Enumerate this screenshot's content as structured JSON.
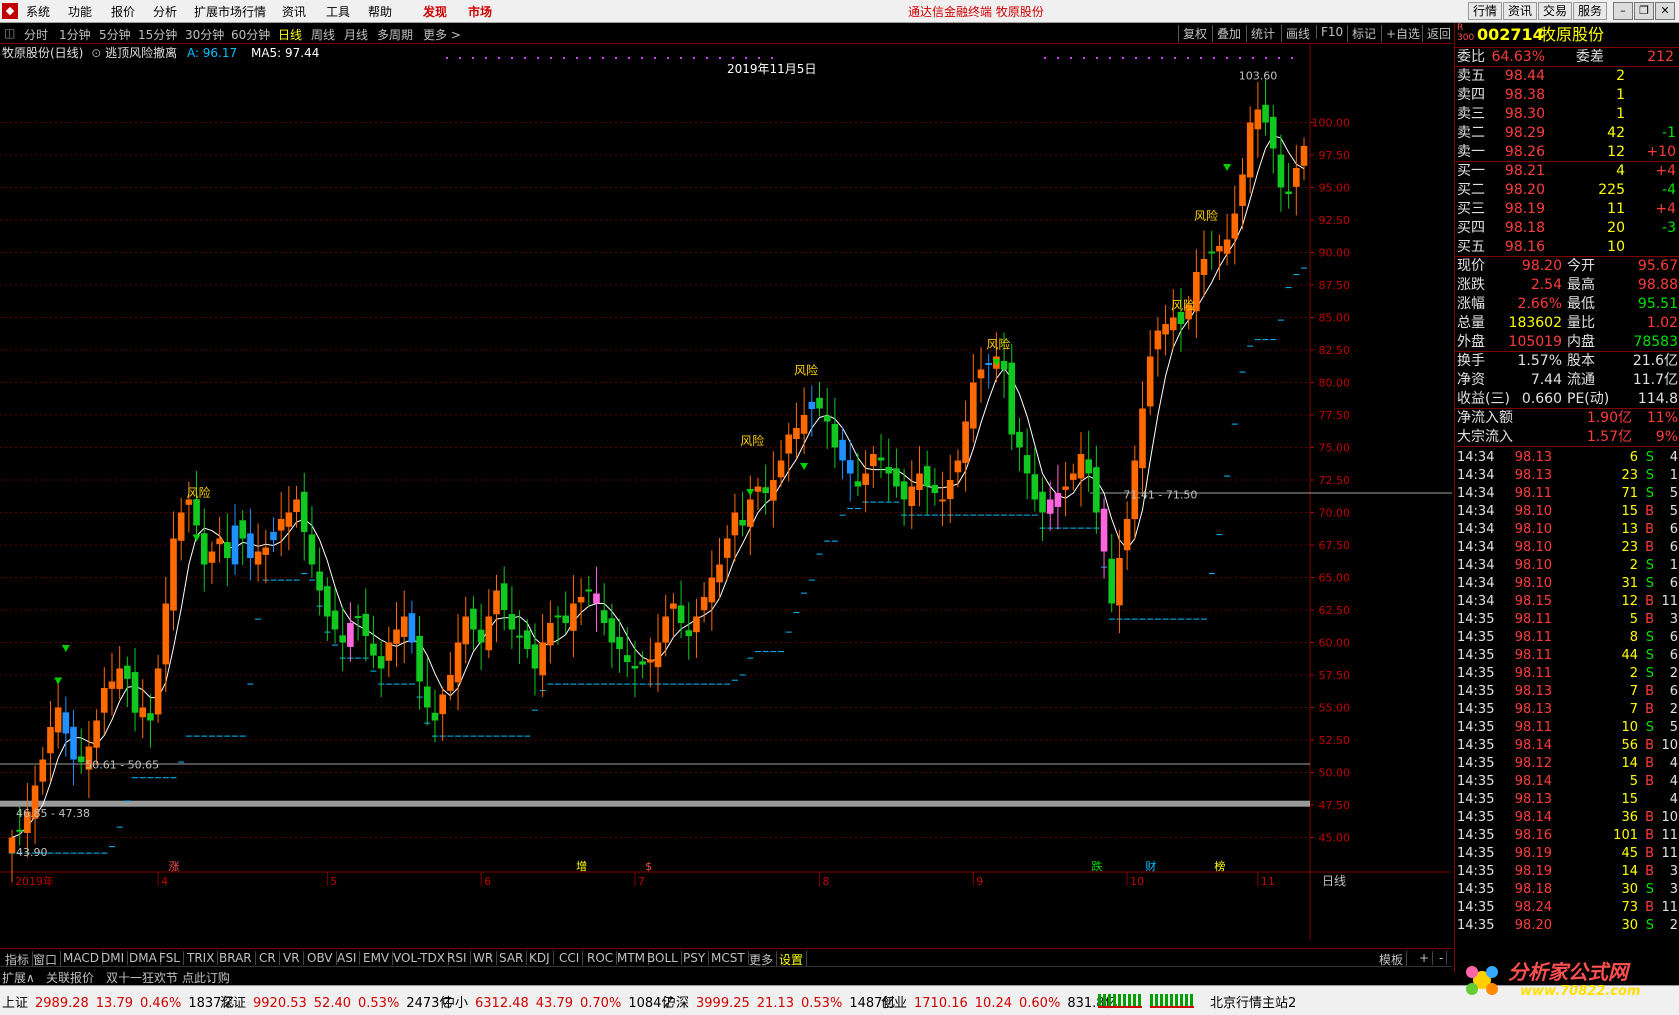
{
  "menu": {
    "items": [
      "系统",
      "功能",
      "报价",
      "分析",
      "扩展市场行情",
      "资讯",
      "工具",
      "帮助"
    ],
    "highlight_items": [
      "发现",
      "市场"
    ],
    "center_title": "通达信金融终端  牧原股份",
    "right_buttons": [
      "行情",
      "资讯",
      "交易",
      "服务"
    ]
  },
  "periods": {
    "items": [
      "分时",
      "1分钟",
      "5分钟",
      "15分钟",
      "30分钟",
      "60分钟",
      "日线",
      "周线",
      "月线",
      "多周期",
      "更多 >"
    ],
    "active": "日线",
    "tools": [
      "复权",
      "叠加",
      "统计",
      "画线",
      "F10",
      "标记",
      "+自选",
      "返回"
    ]
  },
  "chart_header": {
    "title": "牧原股份(日线)",
    "indicator": "逃顶风险撤离",
    "a_label": "A: 96.17",
    "ma_label": "MA5: 97.44",
    "date_label": "2019年11月5日"
  },
  "chart_data": {
    "type": "candlestick",
    "ylim": [
      42.5,
      104.5
    ],
    "y_ticks": [
      45.0,
      47.5,
      50.0,
      52.5,
      55.0,
      57.5,
      60.0,
      62.5,
      65.0,
      67.5,
      70.0,
      72.5,
      75.0,
      77.5,
      80.0,
      82.5,
      85.0,
      87.5,
      90.0,
      92.5,
      95.0,
      97.5,
      100.0
    ],
    "x_labels": [
      "2019年",
      "4",
      "5",
      "6",
      "7",
      "8",
      "9",
      "10",
      "11"
    ],
    "x_label_index": [
      0,
      19,
      41,
      61,
      81,
      105,
      125,
      145,
      162
    ],
    "price_labels": [
      {
        "text": "103.60",
        "i": 159,
        "v": 103.6
      },
      {
        "text": "50.61 - 50.65",
        "i": 9,
        "v": 50.6
      },
      {
        "text": "71.41 - 71.50",
        "i": 144,
        "v": 71.4
      },
      {
        "text": "46.85 - 47.38",
        "i": 0,
        "v": 46.9
      },
      {
        "text": "43.90",
        "i": 0,
        "v": 43.9
      }
    ],
    "risk_labels": [
      {
        "text": "风险",
        "i": 24,
        "v": 71.2
      },
      {
        "text": "风险",
        "i": 96,
        "v": 75.2
      },
      {
        "text": "风险",
        "i": 103,
        "v": 80.6
      },
      {
        "text": "风险",
        "i": 128,
        "v": 82.6
      },
      {
        "text": "风险",
        "i": 152,
        "v": 85.6
      },
      {
        "text": "风险",
        "i": 155,
        "v": 92.5
      }
    ],
    "event_markers": [
      {
        "text": "涨",
        "i": 21,
        "color": "#ff5050"
      },
      {
        "text": "增",
        "i": 74,
        "color": "#ffff00"
      },
      {
        "text": "$",
        "i": 83,
        "color": "#ff5050"
      },
      {
        "text": "跌",
        "i": 141,
        "color": "#00e000"
      },
      {
        "text": "财",
        "i": 148,
        "color": "#00c0ff"
      },
      {
        "text": "榜",
        "i": 157,
        "color": "#ffff00"
      }
    ],
    "close": [
      45.0,
      45.5,
      47.0,
      49.0,
      51.0,
      53.5,
      55.0,
      53.0,
      51.0,
      50.8,
      52.0,
      54.0,
      56.5,
      57.0,
      58.0,
      57.2,
      54.6,
      55.0,
      54.0,
      58.0,
      63.0,
      68.0,
      70.0,
      71.0,
      69.0,
      66.0,
      67.0,
      68.0,
      66.5,
      69.0,
      68.0,
      66.5,
      67.0,
      67.3,
      68.5,
      69.5,
      70.0,
      71.0,
      68.5,
      66.0,
      64.0,
      62.0,
      61.0,
      60.0,
      61.5,
      62.0,
      60.5,
      59.0,
      58.0,
      60.0,
      61.0,
      62.0,
      60.0,
      57.0,
      55.0,
      54.0,
      56.0,
      57.5,
      60.0,
      62.0,
      61.0,
      60.0,
      62.0,
      64.0,
      62.5,
      61.0,
      60.5,
      59.5,
      58.0,
      60.0,
      61.5,
      62.0,
      61.5,
      63.0,
      63.5,
      64.0,
      63.0,
      61.5,
      60.0,
      59.5,
      58.5,
      58.0,
      58.3,
      58.7,
      60.0,
      62.0,
      63.0,
      61.5,
      60.5,
      62.0,
      63.5,
      65.0,
      66.0,
      68.0,
      70.0,
      69.0,
      71.0,
      72.0,
      71.5,
      72.5,
      74.0,
      76.0,
      76.5,
      77.5,
      78.5,
      78.0,
      77.0,
      75.0,
      74.0,
      73.0,
      72.0,
      73.0,
      74.5,
      74.0,
      73.0,
      72.0,
      71.0,
      72.0,
      73.0,
      72.0,
      71.5,
      71.0,
      72.5,
      74.0,
      77.0,
      80.0,
      81.0,
      81.5,
      82.0,
      81.0,
      76.0,
      75.0,
      73.0,
      71.0,
      70.0,
      71.0,
      71.5,
      72.0,
      73.0,
      74.5,
      73.0,
      70.0,
      67.0,
      63.0,
      66.5,
      69.5,
      74.0,
      78.0,
      82.0,
      84.0,
      84.5,
      85.0,
      84.5,
      86.0,
      88.5,
      89.5,
      90.0,
      90.5,
      91.0,
      93.0,
      96.0,
      100.0,
      101.0,
      100.0,
      98.0,
      95.0,
      94.5,
      96.5,
      98.2
    ],
    "series": [
      {
        "name": "MA5",
        "color": "#ffffff"
      },
      {
        "name": "A",
        "color": "#00c0ff"
      }
    ]
  },
  "quote": {
    "code": "002714",
    "name": "牧原股份",
    "rows": [
      {
        "label": "委比",
        "value": "64.63%",
        "label2": "委差",
        "value2": "212",
        "vc": "red",
        "vc2": "red"
      }
    ],
    "asks": [
      {
        "label": "卖五",
        "price": "98.44",
        "vol": "2",
        "chg": ""
      },
      {
        "label": "卖四",
        "price": "98.38",
        "vol": "1",
        "chg": ""
      },
      {
        "label": "卖三",
        "price": "98.30",
        "vol": "1",
        "chg": ""
      },
      {
        "label": "卖二",
        "price": "98.29",
        "vol": "42",
        "chg": "-1"
      },
      {
        "label": "卖一",
        "price": "98.26",
        "vol": "12",
        "chg": "+10"
      }
    ],
    "bids": [
      {
        "label": "买一",
        "price": "98.21",
        "vol": "4",
        "chg": "+4"
      },
      {
        "label": "买二",
        "price": "98.20",
        "vol": "225",
        "chg": "-4"
      },
      {
        "label": "买三",
        "price": "98.19",
        "vol": "11",
        "chg": "+4"
      },
      {
        "label": "买四",
        "price": "98.18",
        "vol": "20",
        "chg": "-3"
      },
      {
        "label": "买五",
        "price": "98.16",
        "vol": "10",
        "chg": ""
      }
    ],
    "stats": [
      {
        "l1": "现价",
        "v1": "98.20",
        "c1": "red",
        "l2": "今开",
        "v2": "95.67",
        "c2": "red"
      },
      {
        "l1": "涨跌",
        "v1": "2.54",
        "c1": "red",
        "l2": "最高",
        "v2": "98.88",
        "c2": "red"
      },
      {
        "l1": "涨幅",
        "v1": "2.66%",
        "c1": "red",
        "l2": "最低",
        "v2": "95.51",
        "c2": "green"
      },
      {
        "l1": "总量",
        "v1": "183602",
        "c1": "yellow",
        "l2": "量比",
        "v2": "1.02",
        "c2": "red"
      },
      {
        "l1": "外盘",
        "v1": "105019",
        "c1": "red",
        "l2": "内盘",
        "v2": "78583",
        "c2": "green"
      }
    ],
    "stats2": [
      {
        "l1": "换手",
        "v1": "1.57%",
        "c1": "white",
        "l2": "股本",
        "v2": "21.6亿",
        "c2": "white"
      },
      {
        "l1": "净资",
        "v1": "7.44",
        "c1": "white",
        "l2": "流通",
        "v2": "11.7亿",
        "c2": "white"
      },
      {
        "l1": "收益(三)",
        "v1": "0.660",
        "c1": "white",
        "l2": "PE(动)",
        "v2": "114.8",
        "c2": "white"
      }
    ],
    "flows": [
      {
        "label": "净流入额",
        "value": "1.90亿",
        "pct": "11%"
      },
      {
        "label": "大宗流入",
        "value": "1.57亿",
        "pct": "9%"
      }
    ],
    "ticks": [
      [
        "14:34",
        "98.13",
        "6",
        "S",
        "4"
      ],
      [
        "14:34",
        "98.13",
        "23",
        "S",
        "1"
      ],
      [
        "14:34",
        "98.11",
        "71",
        "S",
        "5"
      ],
      [
        "14:34",
        "98.10",
        "15",
        "B",
        "5"
      ],
      [
        "14:34",
        "98.10",
        "13",
        "B",
        "6"
      ],
      [
        "14:34",
        "98.10",
        "23",
        "B",
        "6"
      ],
      [
        "14:34",
        "98.10",
        "2",
        "S",
        "1"
      ],
      [
        "14:34",
        "98.10",
        "31",
        "S",
        "6"
      ],
      [
        "14:34",
        "98.15",
        "12",
        "B",
        "11"
      ],
      [
        "14:35",
        "98.11",
        "5",
        "B",
        "3"
      ],
      [
        "14:35",
        "98.11",
        "8",
        "S",
        "6"
      ],
      [
        "14:35",
        "98.11",
        "44",
        "S",
        "6"
      ],
      [
        "14:35",
        "98.11",
        "2",
        "S",
        "2"
      ],
      [
        "14:35",
        "98.13",
        "7",
        "B",
        "6"
      ],
      [
        "14:35",
        "98.13",
        "7",
        "B",
        "2"
      ],
      [
        "14:35",
        "98.11",
        "10",
        "S",
        "5"
      ],
      [
        "14:35",
        "98.14",
        "56",
        "B",
        "10"
      ],
      [
        "14:35",
        "98.12",
        "14",
        "B",
        "4"
      ],
      [
        "14:35",
        "98.14",
        "5",
        "B",
        "4"
      ],
      [
        "14:35",
        "98.13",
        "15",
        "",
        "4"
      ],
      [
        "14:35",
        "98.14",
        "36",
        "B",
        "10"
      ],
      [
        "14:35",
        "98.16",
        "101",
        "B",
        "11"
      ],
      [
        "14:35",
        "98.19",
        "45",
        "B",
        "11"
      ],
      [
        "14:35",
        "98.19",
        "14",
        "B",
        "3"
      ],
      [
        "14:35",
        "98.18",
        "30",
        "S",
        "3"
      ],
      [
        "14:35",
        "98.24",
        "73",
        "B",
        "11"
      ],
      [
        "14:35",
        "98.20",
        "30",
        "S",
        "2"
      ]
    ]
  },
  "indicator_bar": {
    "items": [
      "指标",
      "窗口",
      "MACD",
      "DMI",
      "DMA",
      "FSL",
      "TRIX",
      "BRAR",
      "CR",
      "VR",
      "OBV",
      "ASI",
      "EMV",
      "VOL-TDX",
      "RSI",
      "WR",
      "SAR",
      "KDJ",
      "CCI",
      "ROC",
      "MTM",
      "BOLL",
      "PSY",
      "MCST",
      "更多",
      "设置"
    ],
    "right": [
      "模板",
      "+",
      "-"
    ]
  },
  "ext_bar": {
    "items": [
      "扩展∧",
      "关联报价",
      "双十一狂欢节 点此订购"
    ]
  },
  "status": {
    "items": [
      {
        "name": "上证",
        "val": "2989.28",
        "chg": "13.79",
        "pct": "0.46%",
        "amt": "1837亿"
      },
      {
        "name": "深证",
        "val": "9920.53",
        "chg": "52.40",
        "pct": "0.53%",
        "amt": "2473亿"
      },
      {
        "name": "中小",
        "val": "6312.48",
        "chg": "43.79",
        "pct": "0.70%",
        "amt": "1084亿"
      },
      {
        "name": "沪深",
        "val": "3999.25",
        "chg": "21.13",
        "pct": "0.53%",
        "amt": "1487亿"
      },
      {
        "name": "创业",
        "val": "1710.16",
        "chg": "10.24",
        "pct": "0.60%",
        "amt": "831.8亿"
      }
    ],
    "server": "北京行情主站2",
    "axis_mode": "日线"
  },
  "watermark": {
    "title": "分析家公式网",
    "url": "www.70822.com"
  }
}
